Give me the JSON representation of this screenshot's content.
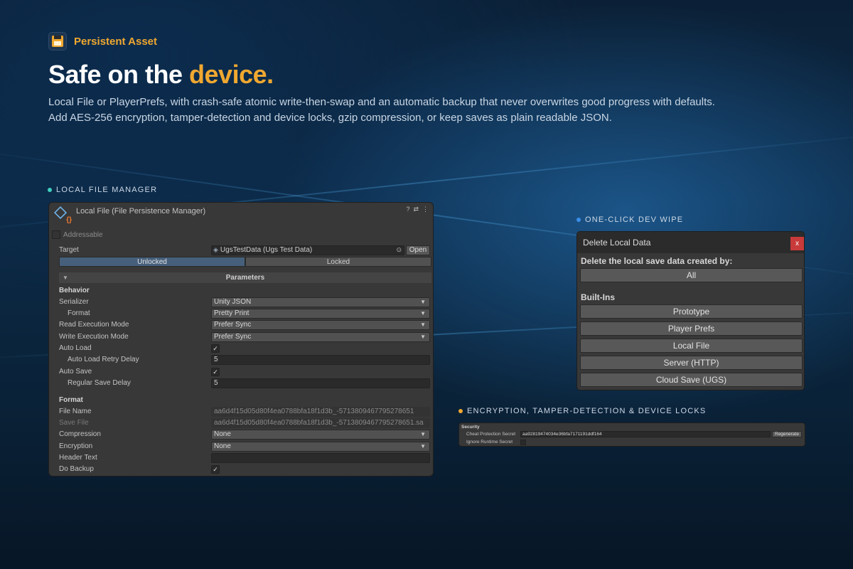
{
  "brand": {
    "name": "Persistent Asset",
    "icon": "floppy-disk-icon"
  },
  "headline": {
    "prefix": "Safe on the ",
    "accent": "device."
  },
  "description": {
    "line1": "Local File or PlayerPrefs, with crash-safe atomic write-then-swap and an automatic backup that never overwrites good progress with defaults.",
    "line2": "Add AES-256 encryption, tamper-detection and device locks, gzip compression, or keep saves as plain readable JSON."
  },
  "colors": {
    "accent": "#f0a830",
    "label_dot_teal": "#3fd0c0",
    "label_dot_blue": "#3a8fe8",
    "label_dot_orange": "#f0a830",
    "close_red": "#c93a3a"
  },
  "sections": {
    "local_file_manager": "LOCAL FILE MANAGER",
    "dev_wipe": "ONE-CLICK DEV WIPE",
    "encryption": "ENCRYPTION, TAMPER-DETECTION & DEVICE LOCKS"
  },
  "inspector": {
    "title": "Local File (File Persistence Manager)",
    "addressable": "Addressable",
    "target_label": "Target",
    "target_value": "UgsTestData (Ugs Test Data)",
    "open_button": "Open",
    "toggle_unlocked": "Unlocked",
    "toggle_locked": "Locked",
    "parameters": "Parameters",
    "behavior_heading": "Behavior",
    "serializer_label": "Serializer",
    "serializer_value": "Unity JSON",
    "format_label": "Format",
    "format_value": "Pretty Print",
    "read_mode_label": "Read Execution Mode",
    "read_mode_value": "Prefer Sync",
    "write_mode_label": "Write Execution Mode",
    "write_mode_value": "Prefer Sync",
    "auto_load_label": "Auto Load",
    "auto_load_checked": "✓",
    "auto_load_retry_label": "Auto Load Retry Delay",
    "auto_load_retry_value": "5",
    "auto_save_label": "Auto Save",
    "auto_save_checked": "✓",
    "regular_save_label": "Regular Save Delay",
    "regular_save_value": "5",
    "format_heading": "Format",
    "file_name_label": "File Name",
    "file_name_value": "aa6d4f15d05d80f4ea0788bfa18f1d3b_-5713809467795278651",
    "save_file_label": "Save File",
    "save_file_value": "aa6d4f15d05d80f4ea0788bfa18f1d3b_-5713809467795278651.sa",
    "compression_label": "Compression",
    "compression_value": "None",
    "encryption_label": "Encryption",
    "encryption_value": "None",
    "header_text_label": "Header Text",
    "header_text_value": "",
    "do_backup_label": "Do Backup",
    "do_backup_checked": "✓"
  },
  "delete_window": {
    "title": "Delete Local Data",
    "close": "x",
    "question": "Delete the local save data created by:",
    "all_button": "All",
    "builtins_heading": "Built-Ins",
    "buttons": [
      "Prototype",
      "Player Prefs",
      "Local File",
      "Server (HTTP)",
      "Cloud Save (UGS)"
    ]
  },
  "security": {
    "heading": "Security",
    "secret_label": "Cheat Protection Secret",
    "secret_value": "aa92819474034e36bfa7171191ddf164",
    "regenerate_button": "Regenerate",
    "ignore_label": "Ignore Runtime Secret"
  }
}
